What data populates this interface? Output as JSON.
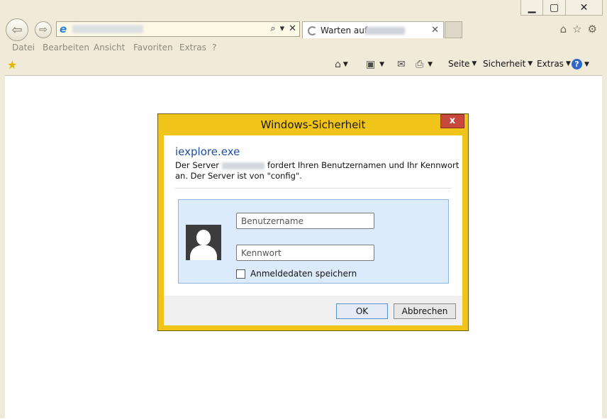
{
  "window_controls": {
    "minimize": "▁",
    "maximize": "▢",
    "close": "✕"
  },
  "nav": {
    "back_icon": "arrow-left-icon",
    "forward_icon": "arrow-right-icon",
    "address_search": "⌕",
    "address_dropdown": "▾",
    "address_stop": "✕",
    "tab_label": "Warten auf",
    "tab_close": "✕"
  },
  "right_icons": {
    "home": "⌂",
    "favorites": "☆",
    "settings": "⚙"
  },
  "menu": [
    "Datei",
    "Bearbeiten",
    "Ansicht",
    "Favoriten",
    "Extras",
    "?"
  ],
  "command_bar": {
    "page": "Seite",
    "security": "Sicherheit",
    "tools": "Extras"
  },
  "dialog": {
    "title": "Windows-Sicherheit",
    "close": "x",
    "app": "iexplore.exe",
    "message_prefix": "Der Server",
    "message_suffix": "fordert Ihren Benutzernamen und Ihr Kennwort",
    "message_line2": "an. Der Server ist von \"config\".",
    "username_placeholder": "Benutzername",
    "password_placeholder": "Kennwort",
    "remember_label": "Anmeldedaten speichern",
    "ok_label": "OK",
    "cancel_label": "Abbrechen"
  }
}
